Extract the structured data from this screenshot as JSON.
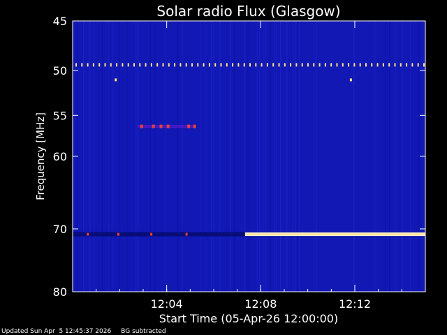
{
  "chart_data": {
    "type": "heatmap",
    "title": "Solar radio Flux (Glasgow)",
    "xlabel": "Start Time (05-Apr-26 12:00:00)",
    "ylabel": "Frequency [MHz]",
    "x_unit": "time",
    "x_range": [
      "12:00:00",
      "12:15:00"
    ],
    "x_ticks": [
      "12:04",
      "12:08",
      "12:12"
    ],
    "y_range": [
      45,
      80
    ],
    "y_ticks": [
      45,
      50,
      55,
      60,
      70,
      80
    ],
    "y_scale": "log",
    "colormap": "blue-red-yellow-white",
    "features": [
      {
        "description": "periodic narrowband spikes",
        "freq_mhz": 49.4,
        "time_start": "12:00:00",
        "time_end": "12:15:00"
      },
      {
        "description": "isolated spike",
        "freq_mhz": 51.0,
        "time": "12:01:50"
      },
      {
        "description": "isolated spike",
        "freq_mhz": 51.0,
        "time": "12:11:50"
      },
      {
        "description": "burst cluster",
        "freq_mhz": 56.3,
        "time_start": "12:02:45",
        "time_end": "12:05:15"
      },
      {
        "description": "strong interference band",
        "freq_mhz": 70.8,
        "time_start": "12:07:20",
        "time_end": "12:15:00"
      }
    ]
  },
  "footer": {
    "updated": "Updated Sun Apr  5 12:45:37 2026",
    "note": "BG subtracted"
  },
  "colors": {
    "background": "#000000",
    "plot_bg": "#1218b4",
    "foreground": "#ffffff",
    "hot": "#ffe08a"
  }
}
